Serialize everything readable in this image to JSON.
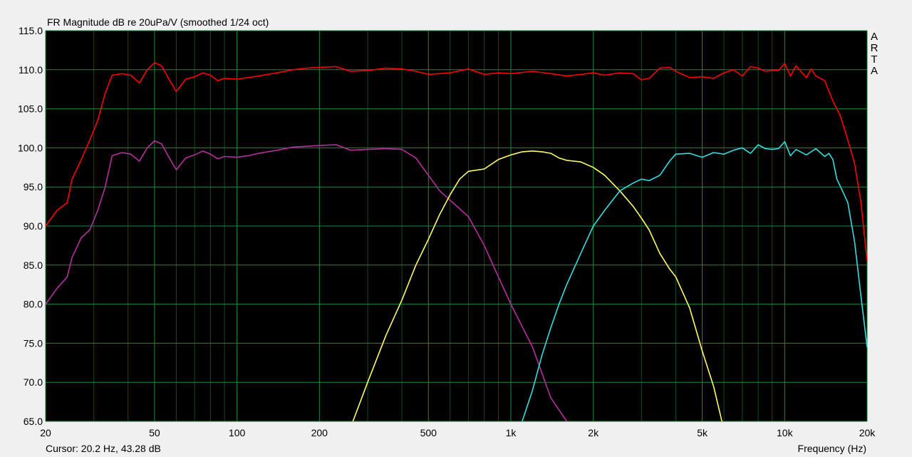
{
  "chart_data": {
    "type": "line",
    "title": "FR Magnitude dB re 20uPa/V (smoothed 1/24 oct)",
    "xlabel": "Frequency (Hz)",
    "ylabel": "",
    "x_scale": "log",
    "xlim": [
      20,
      20000
    ],
    "ylim": [
      65,
      115
    ],
    "grid": true,
    "x_ticks": [
      {
        "value": 20,
        "label": "20"
      },
      {
        "value": 50,
        "label": "50"
      },
      {
        "value": 100,
        "label": "100"
      },
      {
        "value": 200,
        "label": "200"
      },
      {
        "value": 500,
        "label": "500"
      },
      {
        "value": 1000,
        "label": "1k"
      },
      {
        "value": 2000,
        "label": "2k"
      },
      {
        "value": 5000,
        "label": "5k"
      },
      {
        "value": 10000,
        "label": "10k"
      },
      {
        "value": 20000,
        "label": "20k"
      }
    ],
    "y_ticks": [
      {
        "value": 115,
        "label": "115.0"
      },
      {
        "value": 110,
        "label": "110.0"
      },
      {
        "value": 105,
        "label": "105.0"
      },
      {
        "value": 100,
        "label": "100.0"
      },
      {
        "value": 95,
        "label": "95.0"
      },
      {
        "value": 90,
        "label": "90.0"
      },
      {
        "value": 85,
        "label": "85.0"
      },
      {
        "value": 80,
        "label": "80.0"
      },
      {
        "value": 75,
        "label": "75.0"
      },
      {
        "value": 70,
        "label": "70.0"
      },
      {
        "value": 65,
        "label": "65.0"
      }
    ],
    "series": [
      {
        "color": "#ff0000",
        "x": [
          20,
          22,
          24,
          25,
          27,
          29,
          31,
          33,
          35,
          38,
          41,
          44,
          47,
          50,
          53,
          56,
          60,
          65,
          70,
          75,
          80,
          85,
          90,
          100,
          110,
          120,
          140,
          160,
          180,
          200,
          230,
          260,
          300,
          350,
          400,
          450,
          500,
          600,
          700,
          800,
          900,
          1000,
          1200,
          1400,
          1600,
          1800,
          2000,
          2200,
          2500,
          2800,
          3000,
          3200,
          3500,
          3800,
          4000,
          4500,
          5000,
          5500,
          6000,
          6500,
          7000,
          7500,
          8000,
          8500,
          9000,
          9500,
          10000,
          10500,
          11000,
          12000,
          12500,
          13000,
          14000,
          15000,
          16000,
          17000,
          18000,
          19000,
          20000
        ],
        "y": [
          90,
          92,
          93,
          96,
          98.5,
          101,
          103.5,
          107,
          109.3,
          109.5,
          109.3,
          108.3,
          110,
          110.9,
          110.5,
          109,
          107.2,
          108.8,
          109.1,
          109.6,
          109.3,
          108.6,
          108.9,
          108.8,
          109,
          109.2,
          109.6,
          110,
          110.2,
          110.3,
          110.4,
          109.8,
          109.9,
          110.2,
          110.1,
          109.8,
          109.4,
          109.6,
          110.1,
          109.4,
          109.6,
          109.5,
          109.8,
          109.5,
          109.2,
          109.4,
          109.6,
          109.3,
          109.6,
          109.5,
          108.7,
          108.9,
          110.2,
          110.3,
          109.8,
          109,
          109.1,
          108.9,
          109.6,
          110,
          109.2,
          110.4,
          110.2,
          109.8,
          109.9,
          109.9,
          110.8,
          109.2,
          110.5,
          109,
          110.1,
          109.2,
          108.6,
          106,
          104,
          101,
          98,
          93,
          85.5
        ]
      },
      {
        "color": "#b5309a",
        "x": [
          20,
          22,
          24,
          25,
          27,
          29,
          31,
          33,
          35,
          38,
          41,
          44,
          47,
          50,
          53,
          56,
          60,
          65,
          70,
          75,
          80,
          85,
          90,
          100,
          110,
          120,
          140,
          160,
          180,
          200,
          230,
          260,
          300,
          350,
          400,
          450,
          500,
          550,
          600,
          700,
          800,
          900,
          1000,
          1200,
          1400,
          1600
        ],
        "y": [
          80,
          82,
          83.5,
          86,
          88.5,
          89.5,
          92,
          95,
          99,
          99.4,
          99.2,
          98.3,
          100,
          100.9,
          100.5,
          99,
          97.2,
          98.7,
          99.1,
          99.6,
          99.2,
          98.6,
          98.9,
          98.8,
          99,
          99.3,
          99.7,
          100.1,
          100.2,
          100.3,
          100.4,
          99.7,
          99.8,
          99.9,
          99.8,
          98.7,
          96.5,
          94.5,
          93.3,
          91.2,
          87.5,
          83.5,
          80,
          74.5,
          68,
          65
        ]
      },
      {
        "color": "#ffff66",
        "x": [
          265,
          300,
          350,
          400,
          450,
          500,
          550,
          600,
          650,
          700,
          800,
          900,
          1000,
          1100,
          1200,
          1300,
          1400,
          1500,
          1600,
          1700,
          1800,
          2000,
          2200,
          2500,
          2800,
          3000,
          3200,
          3500,
          3800,
          4000,
          4500,
          5000,
          5500,
          5900
        ],
        "y": [
          65,
          70,
          76,
          80.5,
          85,
          88.3,
          91.5,
          94,
          96,
          97,
          97.3,
          98.5,
          99.1,
          99.5,
          99.6,
          99.5,
          99.3,
          98.7,
          98.4,
          98.3,
          98.2,
          97.5,
          96.5,
          94.5,
          92.5,
          91,
          89.5,
          86.5,
          84.5,
          83.5,
          79.5,
          74,
          69.5,
          65
        ]
      },
      {
        "color": "#33dddd",
        "x": [
          1100,
          1200,
          1300,
          1400,
          1500,
          1600,
          1800,
          2000,
          2200,
          2500,
          2800,
          3000,
          3200,
          3500,
          3800,
          4000,
          4500,
          5000,
          5500,
          6000,
          6500,
          7000,
          7500,
          8000,
          8500,
          9000,
          9500,
          10000,
          10500,
          11000,
          12000,
          13000,
          14000,
          14500,
          15000,
          15500,
          16000,
          17000,
          18000,
          19000,
          20000
        ],
        "y": [
          65,
          69,
          73.5,
          77,
          80,
          82.5,
          86.5,
          90,
          92,
          94.5,
          95.5,
          96,
          95.8,
          96.5,
          98.3,
          99.2,
          99.3,
          98.8,
          99.4,
          99.2,
          99.7,
          100,
          99.3,
          100.4,
          99.9,
          99.8,
          99.9,
          100.8,
          99,
          99.8,
          99.1,
          99.9,
          98.9,
          99.3,
          98.5,
          96,
          95,
          93,
          88,
          81,
          74.5
        ]
      }
    ],
    "side_text": [
      "A",
      "R",
      "T",
      "A"
    ],
    "cursor_text": "Cursor: 20.2 Hz, 43.28 dB"
  }
}
